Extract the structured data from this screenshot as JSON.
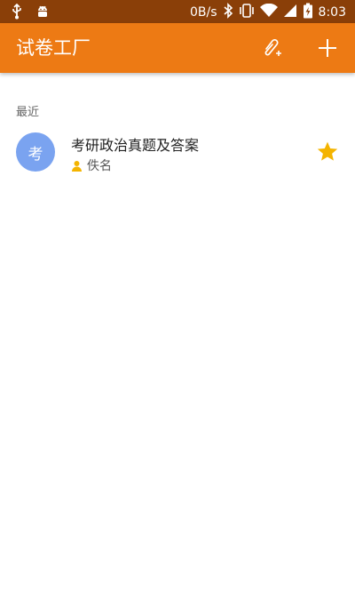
{
  "status_bar": {
    "net_speed": "0B/s",
    "time": "8:03",
    "icons": [
      "usb-icon",
      "android-debug-icon",
      "bluetooth-icon",
      "vibrate-icon",
      "wifi-icon",
      "cell-signal-icon",
      "battery-charging-icon"
    ]
  },
  "app_bar": {
    "title": "试卷工厂",
    "actions": [
      "attach-add-icon",
      "add-icon"
    ],
    "color": "#ed7a14"
  },
  "recent": {
    "header": "最近",
    "items": [
      {
        "avatar_text": "考",
        "avatar_color": "#7aa3f0",
        "title": "考研政治真题及答案",
        "author": "佚名",
        "starred": true,
        "star_color": "#f4b400"
      }
    ]
  }
}
